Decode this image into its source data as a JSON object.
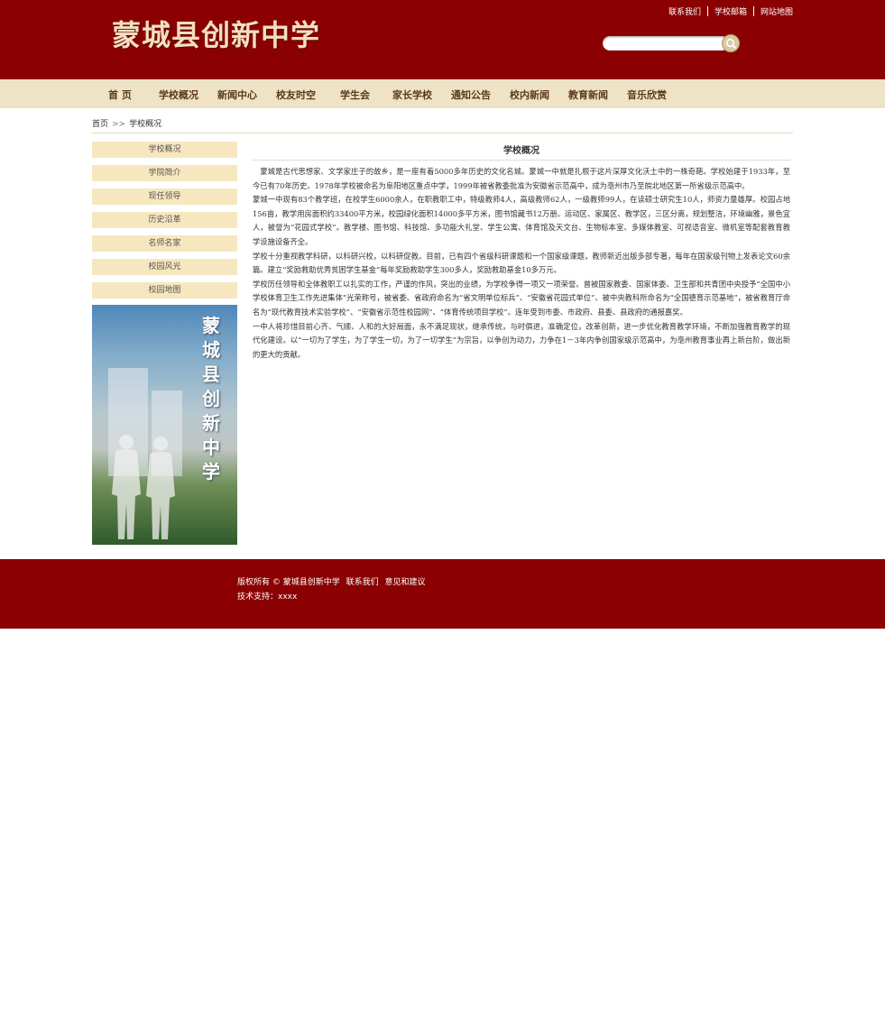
{
  "header": {
    "logo_text": "蒙城县创新中学",
    "top_links": [
      "联系我们",
      "学校邮箱",
      "网站地图"
    ],
    "search_placeholder": ""
  },
  "nav": {
    "items": [
      "首 页",
      "学校概况",
      "新闻中心",
      "校友时空",
      "学生会",
      "家长学校",
      "通知公告",
      "校内新闻",
      "教育新闻",
      "音乐欣赏"
    ]
  },
  "breadcrumb": {
    "home": "首页",
    "separator": ">>",
    "current": "学校概况"
  },
  "sidebar": {
    "items": [
      "学校概况",
      "学院简介",
      "现任领导",
      "历史沿革",
      "名师名家",
      "校园风光",
      "校园地图"
    ],
    "banner_text": "蒙城县创新中学"
  },
  "main": {
    "title": "学校概况",
    "paragraphs": [
      "　蒙城是古代思想家、文学家庄子的故乡，是一座有着5000多年历史的文化名城。蒙城一中就是扎根于这片深厚文化沃土中的一株奇葩。学校始建于1933年，至今已有70年历史。1978年学校被命名为阜阳地区重点中学，1999年被省教委批准为安徽省示范高中，成为亳州市乃至皖北地区第一所省级示范高中。",
      "蒙城一中现有83个教学班，在校学生6000余人，在职教职工中，特级教师4人，高级教师62人，一级教师99人，在读硕士研究生10人，师资力量雄厚。校园占地156亩，教学用房面积约33400平方米，校园绿化面积14000多平方米，图书馆藏书12万册。运动区、家属区、教学区，三区分离，规划整洁，环境幽雅，景色宜人，被誉为“花园式学校”。教学楼、图书馆、科技馆、多功能大礼堂、学生公寓、体育馆及天文台、生物标本室、多媒体教室、可视语音室、微机室等配套教育教学设施设备齐全。",
      "学校十分重视教学科研，以科研兴校，以科研促教。目前，已有四个省级科研课题和一个国家级课题，教师新近出版多部专著，每年在国家级刊物上发表论文60余篇。建立“奖励救助优秀贫困学生基金”每年奖励救助学生300多人，奖励救助基金10多万元。",
      "学校历任领导和全体教职工以扎实的工作，严谨的作风，突出的业绩，为学校争得一项又一项荣誉。曾被国家教委、国家体委、卫生部和共青团中央授予“全国中小学校体育卫生工作先进集体”光荣称号，被省委、省政府命名为“省文明单位标兵”、“安徽省花园式单位”、被中央教科所命名为“全国德育示范基地”，被省教育厅命名为“现代教育技术实验学校”、“安徽省示范性校园网”、“体育传统项目学校”。连年受到市委、市政府、县委、县政府的通报嘉奖。",
      "一中人将珍惜目前心齐、气顺、人和的大好局面，永不满足现状，继承传统，与时俱进，准确定位，改革创新，进一步优化教育教学环境，不断加强教育教学的现代化建设。以“一切为了学生，为了学生一切，为了一切学生”为宗旨，以争创为动力，力争在1－3年内争创国家级示范高中，为亳州教育事业再上新台阶，做出新的更大的贡献。"
    ]
  },
  "footer": {
    "copyright": "版权所有 © 蒙城县创新中学",
    "contact": "联系我们",
    "feedback": "意见和建议",
    "tech_support": "技术支持：xxxx"
  },
  "colors": {
    "brand": "#8b0000",
    "nav_bg": "#eee3c6",
    "sidebar_item_bg": "#f7e7bf"
  }
}
